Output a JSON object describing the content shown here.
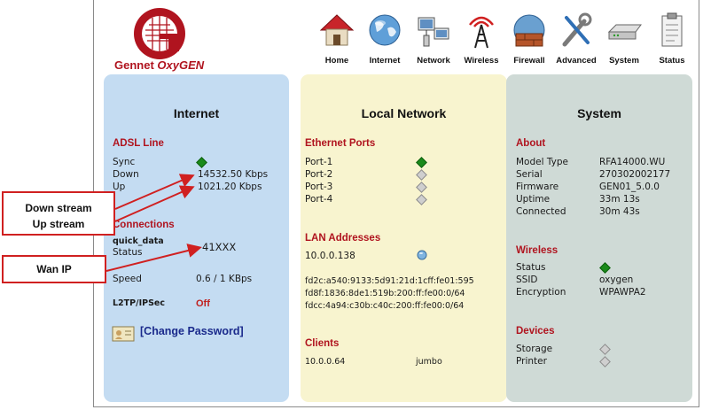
{
  "brand": {
    "name_prefix": "Gennet ",
    "name_suffix": "OxyGEN",
    "accent": "#b0141f"
  },
  "nav": [
    {
      "label": "Home",
      "icon": "home-icon"
    },
    {
      "label": "Internet",
      "icon": "globe-icon"
    },
    {
      "label": "Network",
      "icon": "network-icon"
    },
    {
      "label": "Wireless",
      "icon": "wireless-tower-icon"
    },
    {
      "label": "Firewall",
      "icon": "firewall-icon"
    },
    {
      "label": "Advanced",
      "icon": "tools-icon"
    },
    {
      "label": "System",
      "icon": "router-icon"
    },
    {
      "label": "Status",
      "icon": "clipboard-icon"
    }
  ],
  "internet": {
    "title": "Internet",
    "adsl": {
      "heading": "ADSL Line",
      "sync_label": "Sync",
      "sync_status": "green",
      "down_label": "Down",
      "down_value": "14532.50 Kbps",
      "up_label": "Up",
      "up_value": "1021.20 Kbps"
    },
    "connections": {
      "heading": "Connections",
      "name": "quick_data",
      "status_label": "Status",
      "status_value": "41XXX",
      "speed_label": "Speed",
      "speed_value": "0.6 / 1 KBps",
      "l2tp_label": "L2TP/IPSec",
      "l2tp_value": "Off"
    },
    "change_password": "[Change Password]"
  },
  "local": {
    "title": "Local Network",
    "ethernet": {
      "heading": "Ethernet Ports",
      "ports": [
        {
          "label": "Port-1",
          "status": "green"
        },
        {
          "label": "Port-2",
          "status": "gray"
        },
        {
          "label": "Port-3",
          "status": "gray"
        },
        {
          "label": "Port-4",
          "status": "gray"
        }
      ]
    },
    "lan": {
      "heading": "LAN Addresses",
      "ipv4": "10.0.0.138",
      "ipv6": [
        "fd2c:a540:9133:5d91:21d:1cff:fe01:595",
        "fd8f:1836:8de1:519b:200:ff:fe00:0/64",
        "fdcc:4a94:c30b:c40c:200:ff:fe00:0/64"
      ]
    },
    "clients": {
      "heading": "Clients",
      "ip": "10.0.0.64",
      "name": "jumbo"
    }
  },
  "system": {
    "title": "System",
    "about": {
      "heading": "About",
      "rows": [
        {
          "label": "Model Type",
          "value": "RFA14000.WU"
        },
        {
          "label": "Serial",
          "value": "270302002177"
        },
        {
          "label": "Firmware",
          "value": "GEN01_5.0.0"
        },
        {
          "label": "Uptime",
          "value": "33m 13s"
        },
        {
          "label": "Connected",
          "value": "30m 43s"
        }
      ]
    },
    "wireless": {
      "heading": "Wireless",
      "status_label": "Status",
      "status": "green",
      "ssid_label": "SSID",
      "ssid_value": "oxygen",
      "enc_label": "Encryption",
      "enc_value": "WPAWPA2"
    },
    "devices": {
      "heading": "Devices",
      "items": [
        {
          "label": "Storage",
          "status": "gray"
        },
        {
          "label": "Printer",
          "status": "gray"
        }
      ]
    }
  },
  "annotations": {
    "stream_line1": "Down stream",
    "stream_line2": "Up stream",
    "wan": "Wan IP",
    "color": "#d02020"
  }
}
